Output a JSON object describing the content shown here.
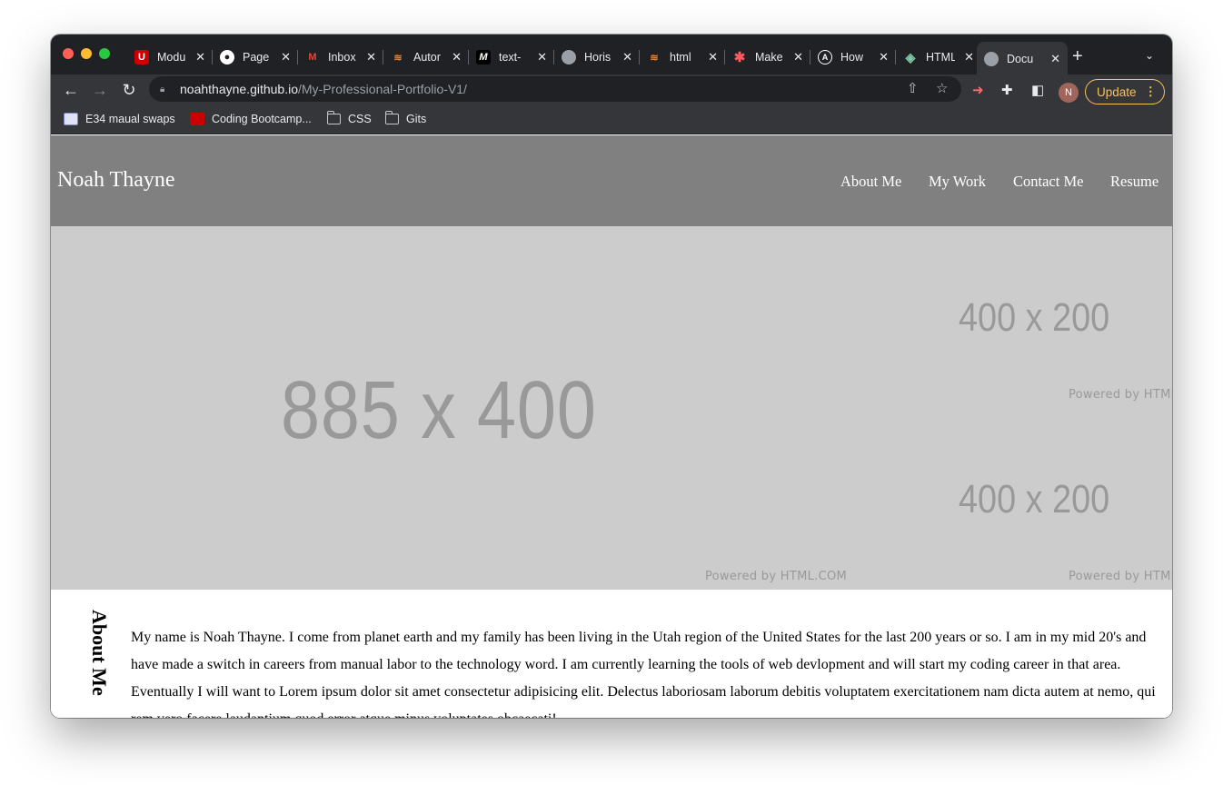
{
  "browser": {
    "tabs": [
      {
        "title": "Modu",
        "icon": "utah-u-icon",
        "color": "#cc0000"
      },
      {
        "title": "Page",
        "icon": "github-icon",
        "color": "#ffffff"
      },
      {
        "title": "Inbox",
        "icon": "gmail-icon",
        "color": "#ea4335"
      },
      {
        "title": "Autor",
        "icon": "stackoverflow-icon",
        "color": "#f48024"
      },
      {
        "title": "text-",
        "icon": "medium-icon",
        "color": "#ffffff"
      },
      {
        "title": "Horis",
        "icon": "globe-icon",
        "color": "#9aa0a6"
      },
      {
        "title": "html",
        "icon": "stackoverflow-icon",
        "color": "#f48024"
      },
      {
        "title": "Make",
        "icon": "asterisk-icon",
        "color": "#ff5a5f"
      },
      {
        "title": "How",
        "icon": "a-logo-icon",
        "color": "#ffffff"
      },
      {
        "title": "HTML",
        "icon": "html-diamond-icon",
        "color": "#7fc7a6"
      },
      {
        "title": "Docu",
        "icon": "globe-icon",
        "color": "#9aa0a6"
      }
    ],
    "new_tab": "+",
    "url_host": "noahthayne.github.io",
    "url_path": "/My-Professional-Portfolio-V1/",
    "profile_initial": "N",
    "update_label": "Update",
    "bookmarks": [
      {
        "label": "E34 maual swaps"
      },
      {
        "label": "Coding Bootcamp..."
      },
      {
        "label": "CSS"
      },
      {
        "label": "Gits"
      }
    ]
  },
  "site": {
    "name": "Noah Thayne",
    "nav": [
      "About Me",
      "My Work",
      "Contact Me",
      "Resume"
    ],
    "hero_main": "885 x 400",
    "hero_side_top": "400 x 200",
    "hero_side_bottom": "400 x 200",
    "powered": "Powered by HTML.COM",
    "powered_cut": "Powered by HTML",
    "about_heading": "About Me",
    "about_text": "My name is Noah Thayne. I come from planet earth and my family has been living in the Utah region of the United States for the last 200 years or so. I am in my mid 20's and have made a switch in careers from manual labor to the technology word. I am currently learning the tools of web devlopment and will start my coding career in that area. Eventually I will want to Lorem ipsum dolor sit amet consectetur adipisicing elit. Delectus laboriosam laborum debitis voluptatem exercitationem nam dicta autem at nemo, qui rem vero facere laudantium quod error atque minus voluptates obcaecati!"
  }
}
